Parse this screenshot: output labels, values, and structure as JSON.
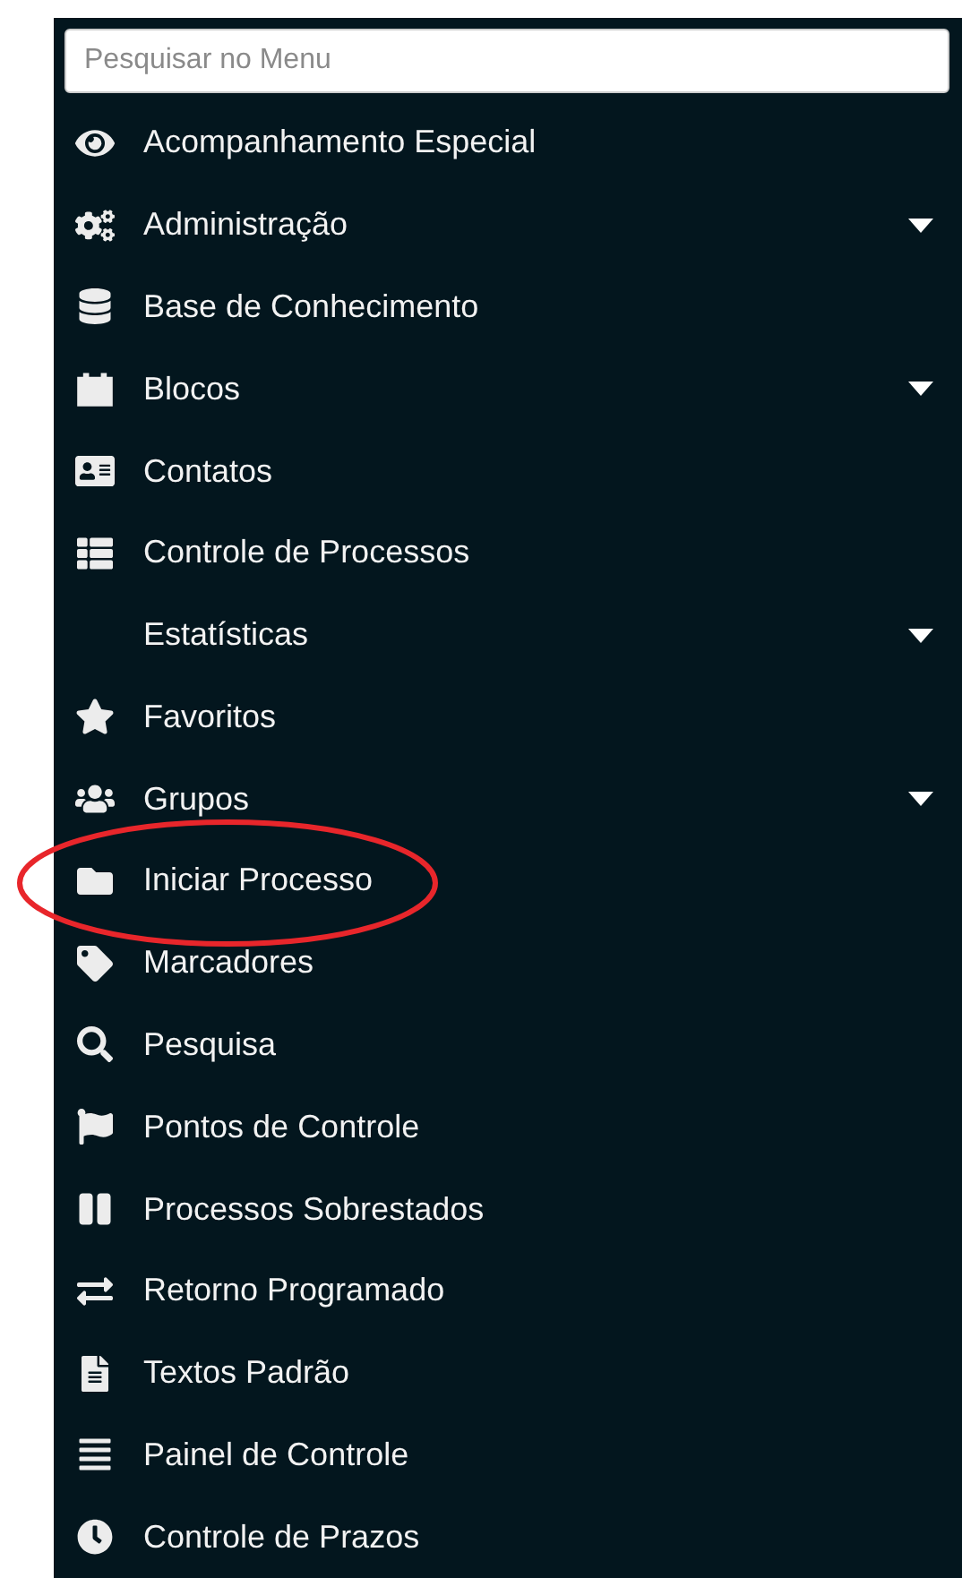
{
  "search": {
    "placeholder": "Pesquisar no Menu"
  },
  "menu": [
    {
      "label": "Acompanhamento Especial",
      "has_submenu": false
    },
    {
      "label": "Administração",
      "has_submenu": true
    },
    {
      "label": "Base de Conhecimento",
      "has_submenu": false
    },
    {
      "label": "Blocos",
      "has_submenu": true
    },
    {
      "label": "Contatos",
      "has_submenu": false
    },
    {
      "label": "Controle de Processos",
      "has_submenu": false
    },
    {
      "label": "Estatísticas",
      "has_submenu": true
    },
    {
      "label": "Favoritos",
      "has_submenu": false
    },
    {
      "label": "Grupos",
      "has_submenu": true
    },
    {
      "label": "Iniciar Processo",
      "has_submenu": false,
      "circled": true
    },
    {
      "label": "Marcadores",
      "has_submenu": false
    },
    {
      "label": "Pesquisa",
      "has_submenu": false
    },
    {
      "label": "Pontos de Controle",
      "has_submenu": false
    },
    {
      "label": "Processos Sobrestados",
      "has_submenu": false
    },
    {
      "label": "Retorno Programado",
      "has_submenu": false
    },
    {
      "label": "Textos Padrão",
      "has_submenu": false
    },
    {
      "label": "Painel de Controle",
      "has_submenu": false
    },
    {
      "label": "Controle de Prazos",
      "has_submenu": false
    }
  ]
}
